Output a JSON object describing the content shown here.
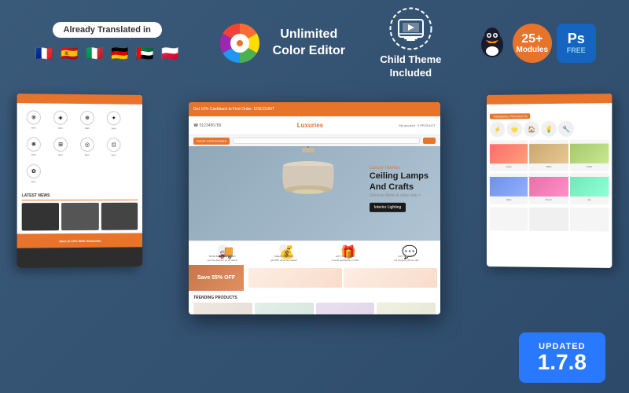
{
  "features": {
    "translated": {
      "badge_label": "Already Translated in",
      "flags": [
        "🇫🇷",
        "🇪🇸",
        "🇮🇹",
        "🇩🇪",
        "🇦🇪",
        "🇵🇱"
      ]
    },
    "color_editor": {
      "title_line1": "Unlimited",
      "title_line2": "Color Editor"
    },
    "child_theme": {
      "title_line1": "Child Theme",
      "title_line2": "Included"
    },
    "modules": {
      "count": "25+",
      "modules_label": "Modules",
      "ps_label": "Ps",
      "free_label": "FREE"
    }
  },
  "center_screenshot": {
    "topbar_text": "Get 10% Cashback to First Order: DISCOUNT",
    "logo": "Luxuries",
    "hero_subtitle": "Luxury Homes",
    "hero_title_line1": "Ceiling Lamps",
    "hero_title_line2": "And Crafts",
    "hero_btn": "Interior Lighting",
    "discover_text": "Discover Items & shop now >",
    "features": [
      {
        "icon": "🚚",
        "text": "WORLDWIDE DELIVERY"
      },
      {
        "icon": "💰",
        "text": "GREAT SAVINGS"
      },
      {
        "icon": "🎁",
        "text": "GIFT VOUCHERS"
      },
      {
        "icon": "💬",
        "text": "24/7 SUPPORT"
      }
    ],
    "trending_title": "TRENDING PRODUCTS",
    "promo_text": "Save 55% OFF"
  },
  "left_screenshot": {
    "news_title": "LATEST NEWS",
    "banner_text": "Save to 10% With Subscribe"
  },
  "right_screenshot": {
    "trending_label": "TRENDING PRODUCTS"
  },
  "updated": {
    "label": "UPDATED",
    "version": "1.7.8"
  }
}
